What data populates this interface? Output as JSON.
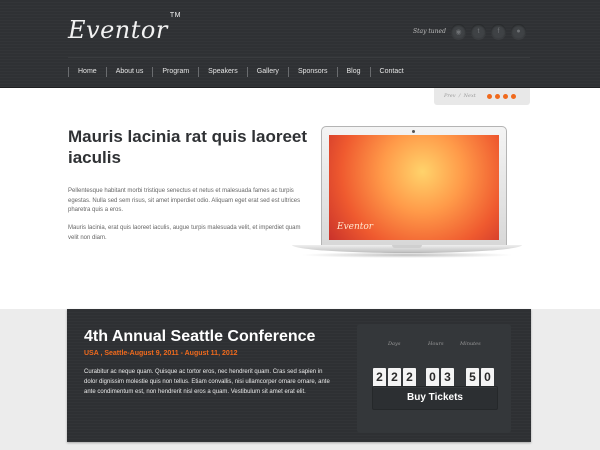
{
  "brand": {
    "logo": "Eventor",
    "trademark": "TM"
  },
  "header": {
    "stay_tuned": "Stay tuned",
    "social_icons": [
      "rss-icon",
      "twitter-icon",
      "facebook-icon",
      "flickr-icon"
    ]
  },
  "nav": [
    "Home",
    "About us",
    "Program",
    "Speakers",
    "Gallery",
    "Sponsors",
    "Blog",
    "Contact"
  ],
  "slider": {
    "prev": "Prev",
    "separator": "/",
    "next": "Next",
    "dots": 4,
    "accent": "#f06a1d"
  },
  "hero": {
    "title": "Mauris lacinia rat quis laoreet iaculis",
    "paragraph1": "Pellentesque habitant morbi tristique senectus et netus et malesuada fames ac turpis egestas. Nulla sed sem risus, sit amet imperdiet odio. Aliquam eget erat sed est ultrices pharetra quis a eros.",
    "paragraph2": "Mauris lacinia, erat quis laoreet iaculis, augue turpis malesuada velit, et imperdiet quam velit non diam.",
    "laptop_screen_text": "Eventor"
  },
  "conference": {
    "title": "4th Annual Seattle Conference",
    "subtitle": "USA , Seattle-August 9, 2011 - August 11, 2012",
    "description": "Curabitur ac neque quam. Quisque ac tortor eros, nec hendrerit quam. Cras sed sapien in dolor dignissim molestie quis non tellus. Etiam convallis, nisi ullamcorper ornare ornare, ante ante condimentum est, non hendrerit nisl eros a quam. Vestibulum sit amet erat elit.",
    "countdown": {
      "days_label": "Days",
      "hours_label": "Hours",
      "minutes_label": "Minutes",
      "days": [
        "2",
        "2",
        "2"
      ],
      "hours": [
        "0",
        "3"
      ],
      "minutes": [
        "5",
        "0"
      ]
    },
    "ticket_button": "Buy Tickets"
  }
}
